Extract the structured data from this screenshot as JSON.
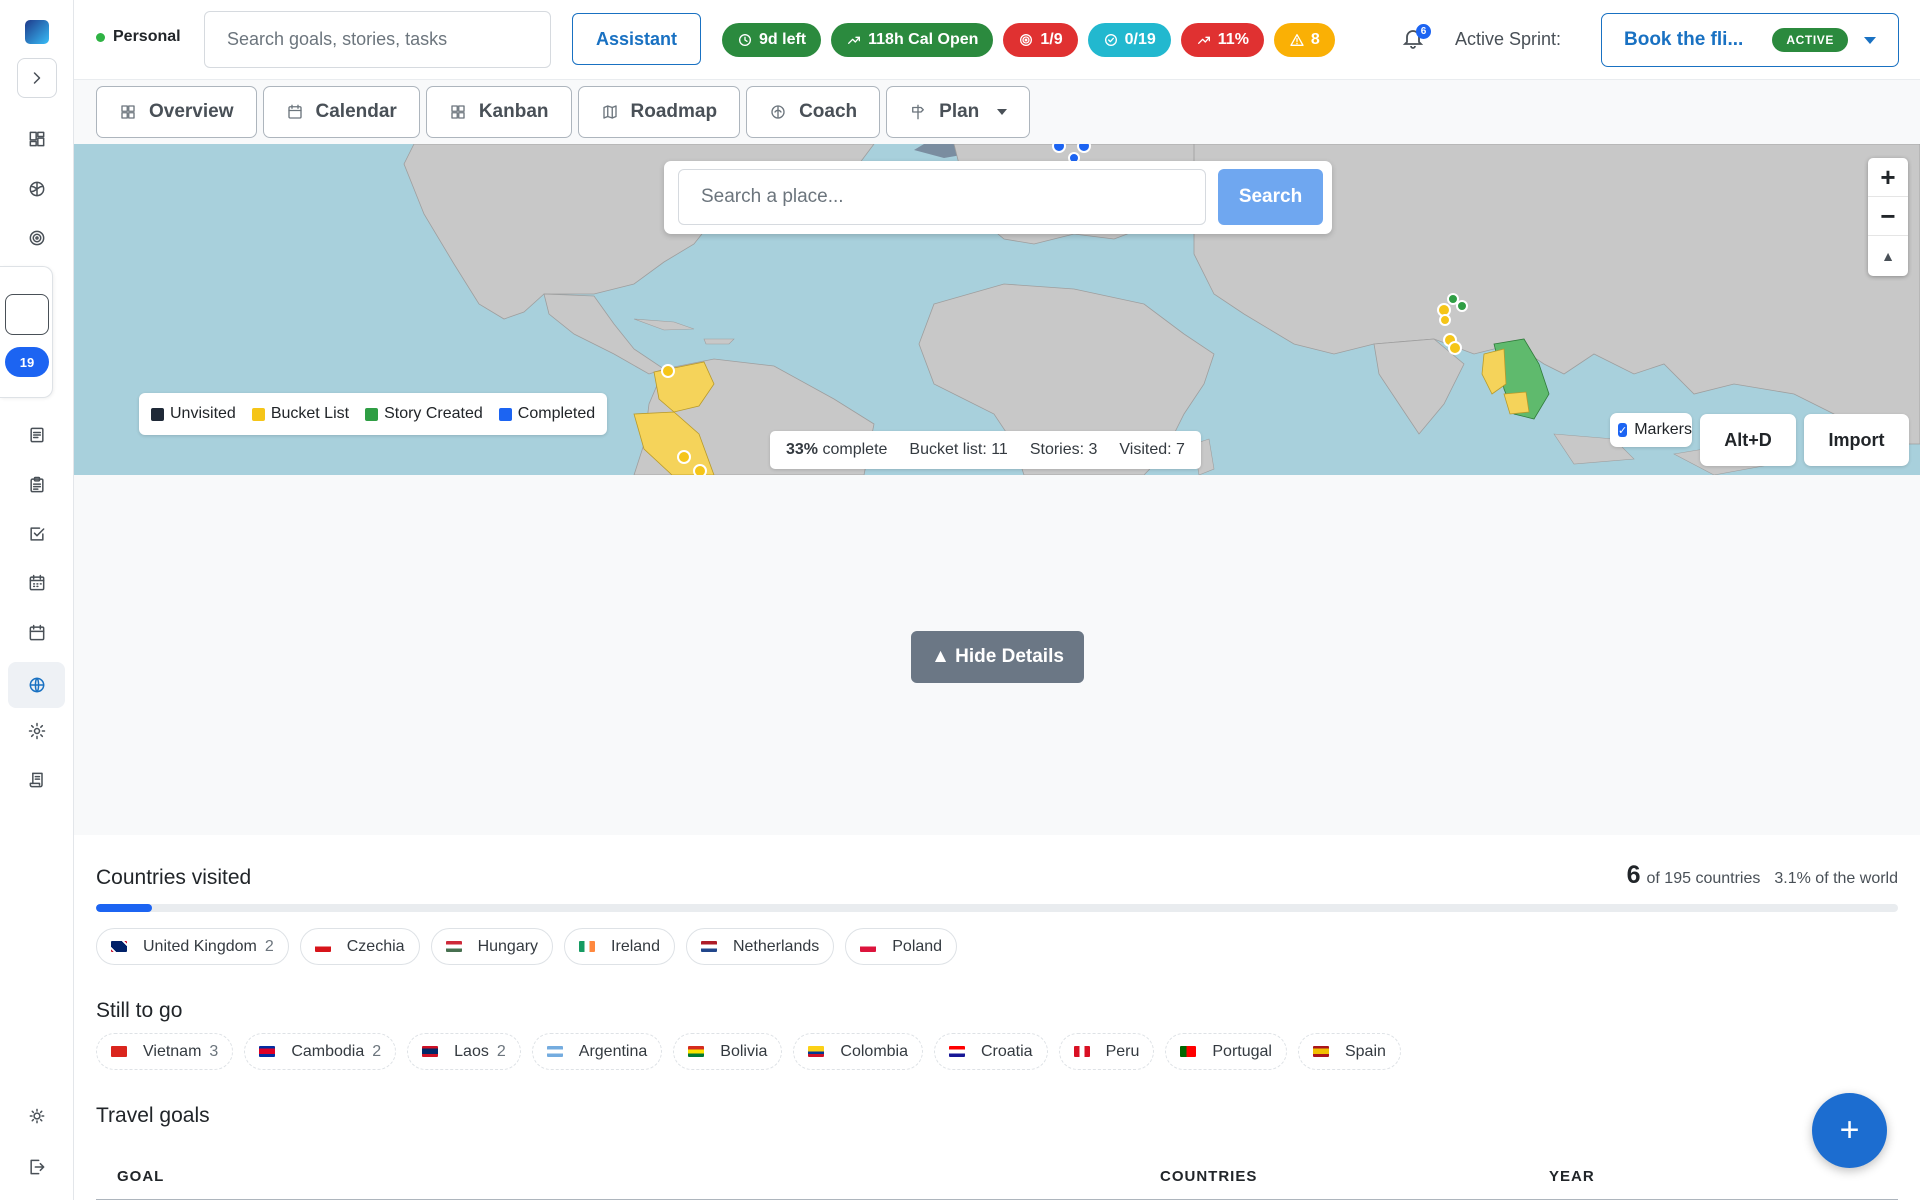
{
  "header": {
    "workspace": "Personal",
    "search_placeholder": "Search goals, stories, tasks",
    "assistant_label": "Assistant",
    "pills": [
      {
        "label": "9d left",
        "icon": "clock-icon",
        "color": "#2b8a3e"
      },
      {
        "label": "118h Cal Open",
        "icon": "trend-up-icon",
        "color": "#2b8a3e"
      },
      {
        "label": "1/9",
        "icon": "target-icon",
        "color": "#e03131"
      },
      {
        "label": "0/19",
        "icon": "check-circle-icon",
        "color": "#22b8cf"
      },
      {
        "label": "11%",
        "icon": "trend-up-icon",
        "color": "#e03131"
      },
      {
        "label": "8",
        "icon": "warning-icon",
        "color": "#fab005"
      }
    ],
    "notification_count": "6",
    "sprint_label": "Active Sprint:",
    "sprint_name": "Book the fli...",
    "sprint_status": "ACTIVE"
  },
  "sidebar": {
    "sprint_badge": "19"
  },
  "tabs": [
    {
      "label": "Overview",
      "icon": "grid-icon"
    },
    {
      "label": "Calendar",
      "icon": "calendar-icon"
    },
    {
      "label": "Kanban",
      "icon": "kanban-icon"
    },
    {
      "label": "Roadmap",
      "icon": "map-icon"
    },
    {
      "label": "Coach",
      "icon": "coach-icon"
    },
    {
      "label": "Plan",
      "icon": "signpost-icon"
    }
  ],
  "map": {
    "search_placeholder": "Search a place...",
    "search_button": "Search",
    "zoom_in": "+",
    "zoom_out": "−",
    "compass": "▲",
    "legend": [
      {
        "label": "Unvisited",
        "color": "#1f2937"
      },
      {
        "label": "Bucket List",
        "color": "#f5c518"
      },
      {
        "label": "Story Created",
        "color": "#2f9e44"
      },
      {
        "label": "Completed",
        "color": "#1c64f2"
      }
    ],
    "stats": {
      "complete_pct": "33%",
      "complete_label": "complete",
      "bucket": "Bucket list: 11",
      "stories": "Stories: 3",
      "visited": "Visited: 7"
    },
    "markers_label": "Markers",
    "shortcut_label": "Alt+D",
    "import_label": "Import"
  },
  "details": {
    "hide_label": "▲ Hide Details"
  },
  "countries_visited": {
    "title": "Countries visited",
    "count": "6",
    "of_label": "of 195 countries",
    "world_pct": "3.1% of the world",
    "progress_fraction": 0.031,
    "chips": [
      {
        "name": "United Kingdom",
        "count": "2",
        "flag": "gb"
      },
      {
        "name": "Czechia",
        "count": "",
        "flag": "cz"
      },
      {
        "name": "Hungary",
        "count": "",
        "flag": "hu"
      },
      {
        "name": "Ireland",
        "count": "",
        "flag": "ie"
      },
      {
        "name": "Netherlands",
        "count": "",
        "flag": "nl"
      },
      {
        "name": "Poland",
        "count": "",
        "flag": "pl"
      }
    ]
  },
  "still_to_go": {
    "title": "Still to go",
    "chips": [
      {
        "name": "Vietnam",
        "count": "3",
        "flag": "vn"
      },
      {
        "name": "Cambodia",
        "count": "2",
        "flag": "kh"
      },
      {
        "name": "Laos",
        "count": "2",
        "flag": "la"
      },
      {
        "name": "Argentina",
        "count": "",
        "flag": "ar"
      },
      {
        "name": "Bolivia",
        "count": "",
        "flag": "bo"
      },
      {
        "name": "Colombia",
        "count": "",
        "flag": "co"
      },
      {
        "name": "Croatia",
        "count": "",
        "flag": "hr"
      },
      {
        "name": "Peru",
        "count": "",
        "flag": "pe"
      },
      {
        "name": "Portugal",
        "count": "",
        "flag": "pt"
      },
      {
        "name": "Spain",
        "count": "",
        "flag": "es"
      }
    ]
  },
  "travel_goals": {
    "title": "Travel goals",
    "columns": [
      "GOAL",
      "COUNTRIES",
      "YEAR"
    ]
  },
  "fab_label": "+"
}
